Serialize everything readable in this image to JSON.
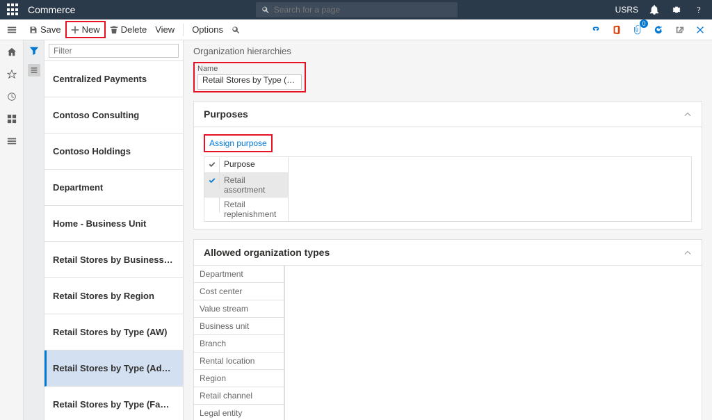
{
  "topbar": {
    "brand": "Commerce",
    "search_placeholder": "Search for a page",
    "user": "USRS"
  },
  "toolbar": {
    "save": "Save",
    "new": "New",
    "delete": "Delete",
    "view": "View",
    "options": "Options",
    "badge_count": "0"
  },
  "list": {
    "filter_placeholder": "Filter",
    "items": [
      "Centralized Payments",
      "Contoso Consulting",
      "Contoso Holdings",
      "Department",
      "Home - Business Unit",
      "Retail Stores by Business Unit",
      "Retail Stores by Region",
      "Retail Stores by Type (AW)",
      "Retail Stores by Type (Advent",
      "Retail Stores by Type (Fabrik..."
    ],
    "selected_index": 8
  },
  "detail": {
    "page_title": "Organization hierarchies",
    "name_label": "Name",
    "name_value": "Retail Stores by Type (Adventur…",
    "purposes": {
      "title": "Purposes",
      "assign_label": "Assign purpose",
      "header": "Purpose",
      "rows": [
        {
          "label": "Retail assortment",
          "checked": true,
          "selected": true
        },
        {
          "label": "Retail replenishment",
          "checked": false,
          "selected": false
        }
      ]
    },
    "allowed": {
      "title": "Allowed organization types",
      "rows": [
        "Department",
        "Cost center",
        "Value stream",
        "Business unit",
        "Branch",
        "Rental location",
        "Region",
        "Retail channel",
        "Legal entity"
      ]
    }
  }
}
